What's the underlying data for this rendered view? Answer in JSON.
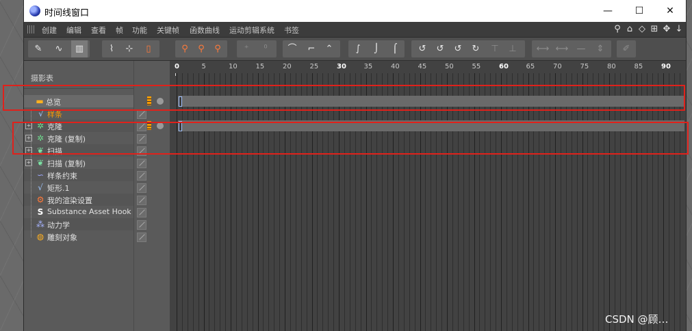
{
  "window": {
    "title": "时间线窗口",
    "minimize": "—",
    "maximize": "☐",
    "close": "✕"
  },
  "menu": {
    "items": [
      "创建",
      "编辑",
      "查看",
      "帧",
      "功能",
      "关键帧",
      "函数曲线",
      "运动剪辑系统",
      "书签"
    ],
    "nav_icons": [
      "search-icon",
      "home-icon",
      "orbit-icon",
      "fit-icon",
      "move-icon",
      "down-arrow-icon"
    ]
  },
  "left_panel": {
    "header": "摄影表",
    "rows": [
      {
        "label": "总览",
        "icon": "folder-icon",
        "orange": false
      },
      {
        "label": "样条",
        "icon": "spline-icon",
        "orange": true
      },
      {
        "label": "克隆",
        "icon": "cloner-icon",
        "orange": false
      },
      {
        "label": "克隆 (复制)",
        "icon": "cloner-icon",
        "orange": false
      },
      {
        "label": "扫描",
        "icon": "sweep-icon",
        "orange": false
      },
      {
        "label": "扫描 (复制)",
        "icon": "sweep-icon",
        "orange": false
      },
      {
        "label": "样条约束",
        "icon": "spline-wrap-icon",
        "orange": false
      },
      {
        "label": "矩形.1",
        "icon": "rectangle-spline-icon",
        "orange": false
      },
      {
        "label": "我的渲染设置",
        "icon": "render-settings-icon",
        "orange": false
      },
      {
        "label": "Substance Asset Hook",
        "icon": "substance-icon",
        "orange": false
      },
      {
        "label": "动力学",
        "icon": "dynamics-icon",
        "orange": false
      },
      {
        "label": "雕刻对象",
        "icon": "sculpt-icon",
        "orange": false
      }
    ]
  },
  "timeline": {
    "ticks": [
      "0",
      "5",
      "10",
      "15",
      "20",
      "25",
      "30",
      "35",
      "40",
      "45",
      "50",
      "55",
      "60",
      "65",
      "70",
      "75",
      "80",
      "85",
      "90"
    ],
    "bold_ticks": [
      "0",
      "30",
      "60",
      "90"
    ]
  },
  "colors": {
    "accent_orange": "#ff9c00",
    "annotation_red": "#e0211b",
    "keyframe_blue": "#9fc0ff"
  },
  "watermark": "CSDN @顾…"
}
